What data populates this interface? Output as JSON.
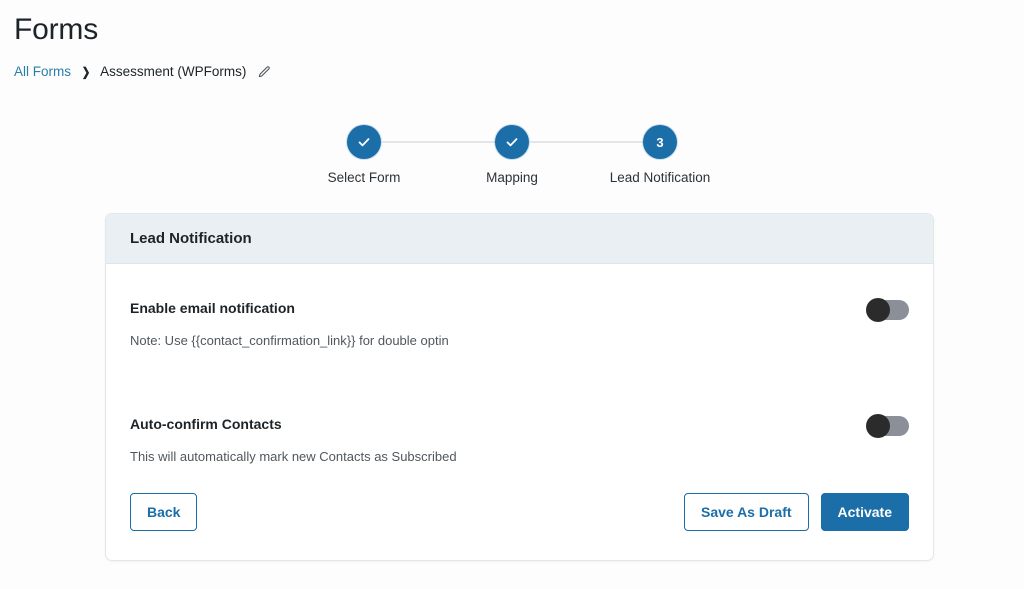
{
  "page": {
    "title": "Forms"
  },
  "breadcrumb": {
    "root_label": "All Forms",
    "separator": "❯",
    "current_label": "Assessment (WPForms)",
    "edit_icon": "pencil-icon"
  },
  "stepper": {
    "steps": [
      {
        "label": "Select Form",
        "state": "complete",
        "indicator": "check-icon"
      },
      {
        "label": "Mapping",
        "state": "complete",
        "indicator": "check-icon"
      },
      {
        "label": "Lead Notification",
        "state": "active",
        "indicator": "3"
      }
    ]
  },
  "card": {
    "header_title": "Lead Notification",
    "settings": [
      {
        "label": "Enable email notification",
        "note": "Note: Use {{contact_confirmation_link}} for double optin",
        "toggle_state": "off"
      },
      {
        "label": "Auto-confirm Contacts",
        "note": "This will automatically mark new Contacts as Subscribed",
        "toggle_state": "off"
      }
    ],
    "footer": {
      "back_label": "Back",
      "save_draft_label": "Save As Draft",
      "activate_label": "Activate"
    }
  },
  "colors": {
    "accent_blue": "#1b6ea8",
    "link_blue": "#2a7fa8",
    "header_band": "#eaeff3",
    "toggle_track_off": "#8a8f98",
    "toggle_knob_off": "#2b2b2b",
    "page_background": "#fdfdfd"
  }
}
